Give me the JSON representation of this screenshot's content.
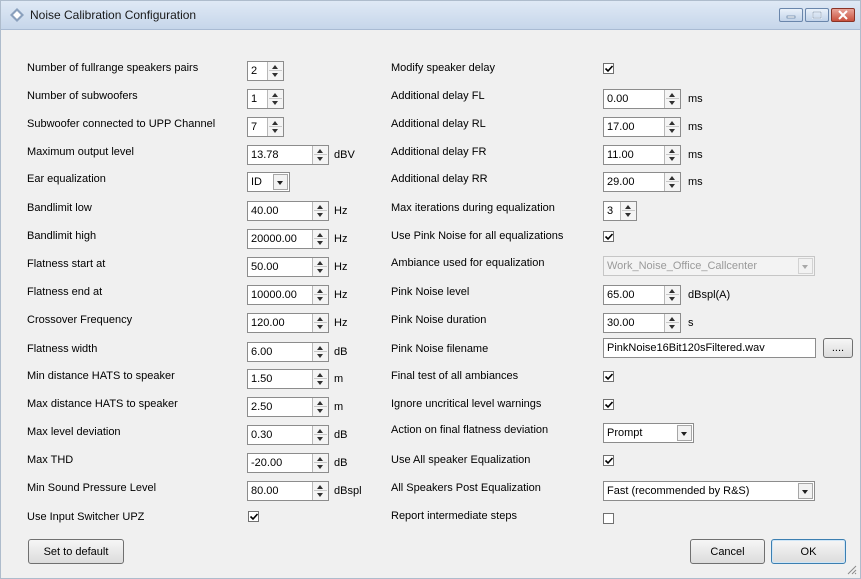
{
  "window": {
    "title": "Noise Calibration Configuration"
  },
  "left": {
    "speaker_pairs": {
      "label": "Number of fullrange speakers pairs",
      "value": "2"
    },
    "subwoofers": {
      "label": "Number of subwoofers",
      "value": "1"
    },
    "sub_channel": {
      "label": "Subwoofer connected to UPP Channel",
      "value": "7"
    },
    "max_output": {
      "label": "Maximum output level",
      "value": "13.78",
      "unit": "dBV"
    },
    "ear_eq": {
      "label": "Ear equalization",
      "value": "ID"
    },
    "bandlimit_low": {
      "label": "Bandlimit low",
      "value": "40.00",
      "unit": "Hz"
    },
    "bandlimit_high": {
      "label": "Bandlimit high",
      "value": "20000.00",
      "unit": "Hz"
    },
    "flatness_start": {
      "label": "Flatness start at",
      "value": "50.00",
      "unit": "Hz"
    },
    "flatness_end": {
      "label": "Flatness end at",
      "value": "10000.00",
      "unit": "Hz"
    },
    "crossover": {
      "label": "Crossover Frequency",
      "value": "120.00",
      "unit": "Hz"
    },
    "flatness_width": {
      "label": "Flatness width",
      "value": "6.00",
      "unit": "dB"
    },
    "min_distance": {
      "label": "Min distance HATS to speaker",
      "value": "1.50",
      "unit": "m"
    },
    "max_distance": {
      "label": "Max distance HATS to speaker",
      "value": "2.50",
      "unit": "m"
    },
    "max_level_dev": {
      "label": "Max level deviation",
      "value": "0.30",
      "unit": "dB"
    },
    "max_thd": {
      "label": "Max THD",
      "value": "-20.00",
      "unit": "dB"
    },
    "min_spl": {
      "label": "Min Sound Pressure Level",
      "value": "80.00",
      "unit": "dBspl"
    },
    "input_switcher": {
      "label": "Use Input Switcher UPZ",
      "checked": true
    }
  },
  "right": {
    "modify_delay": {
      "label": "Modify speaker delay",
      "checked": true
    },
    "delay_fl": {
      "label": "Additional delay FL",
      "value": "0.00",
      "unit": "ms"
    },
    "delay_rl": {
      "label": "Additional delay RL",
      "value": "17.00",
      "unit": "ms"
    },
    "delay_fr": {
      "label": "Additional delay FR",
      "value": "11.00",
      "unit": "ms"
    },
    "delay_rr": {
      "label": "Additional delay RR",
      "value": "29.00",
      "unit": "ms"
    },
    "max_iterations": {
      "label": "Max iterations during equalization",
      "value": "3"
    },
    "use_pink": {
      "label": "Use Pink Noise for all equalizations",
      "checked": true
    },
    "ambiance": {
      "label": "Ambiance used for equalization",
      "value": "Work_Noise_Office_Callcenter",
      "disabled": true
    },
    "pink_level": {
      "label": "Pink Noise level",
      "value": "65.00",
      "unit": "dBspl(A)"
    },
    "pink_duration": {
      "label": "Pink Noise duration",
      "value": "30.00",
      "unit": "s"
    },
    "pink_filename": {
      "label": "Pink Noise filename",
      "value": "PinkNoise16Bit120sFiltered.wav",
      "browse": "...."
    },
    "final_test": {
      "label": "Final test of all ambiances",
      "checked": true
    },
    "ignore_warnings": {
      "label": "Ignore uncritical level warnings",
      "checked": true
    },
    "final_action": {
      "label": "Action on final flatness deviation",
      "value": "Prompt"
    },
    "use_all_eq": {
      "label": "Use All speaker Equalization",
      "checked": true
    },
    "post_eq": {
      "label": "All Speakers Post Equalization",
      "value": "Fast (recommended by R&S)"
    },
    "report_steps": {
      "label": "Report intermediate steps",
      "checked": false
    }
  },
  "buttons": {
    "default": "Set to default",
    "cancel": "Cancel",
    "ok": "OK"
  },
  "icons": {
    "app": "rohde-schwarz-diamond-icon",
    "minimize": "minimize-icon",
    "maximize": "maximize-icon",
    "close": "close-icon",
    "resize": "resize-grip-icon"
  }
}
